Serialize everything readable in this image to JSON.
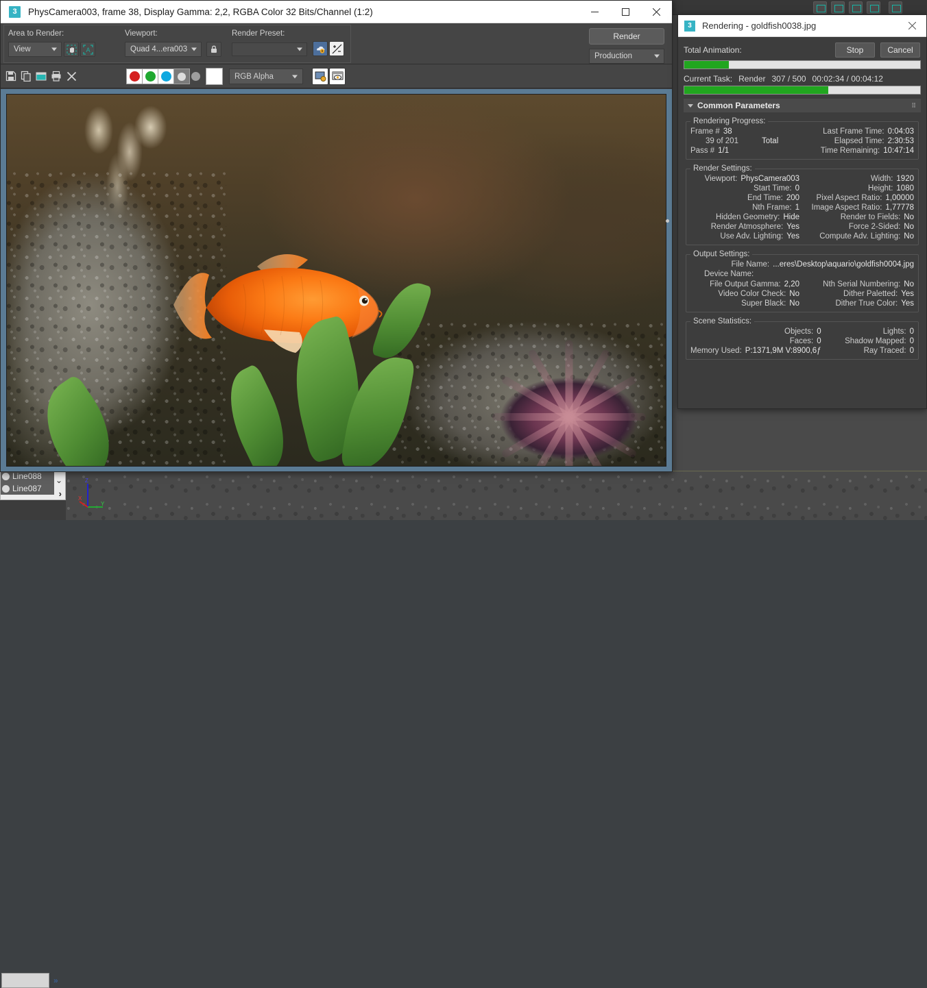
{
  "render_frame_window": {
    "title": "PhysCamera003, frame 38, Display Gamma: 2,2, RGBA Color 32 Bits/Channel (1:2)",
    "app_icon_label": "3",
    "window_controls": {
      "minimize": "–",
      "maximize": "□",
      "close": "✕"
    },
    "toolbar": {
      "area_to_render_label": "Area to Render:",
      "area_to_render_value": "View",
      "viewport_label": "Viewport:",
      "viewport_value": "Quad 4...era003",
      "render_preset_label": "Render Preset:",
      "render_preset_value": "",
      "render_button": "Render",
      "production_value": "Production"
    },
    "toolbar2": {
      "channel_value": "RGB Alpha",
      "icons": [
        "save-icon",
        "copy-icon",
        "clone-icon",
        "print-icon",
        "clear-icon"
      ]
    }
  },
  "rendering_dialog": {
    "title": "Rendering - goldfish0038.jpg",
    "app_icon_label": "3",
    "close_label": "✕",
    "stop_button": "Stop",
    "cancel_button": "Cancel",
    "total_animation_label": "Total Animation:",
    "total_animation_percent": 19,
    "current_task_label": "Current Task:",
    "current_task_name": "Render",
    "current_task_count": "307 / 500",
    "current_task_time": "00:02:34 / 00:04:12",
    "current_task_percent": 61,
    "rollout_title": "Common Parameters",
    "rendering_progress": {
      "legend": "Rendering Progress:",
      "rows": [
        {
          "k": "Frame #",
          "v": "38",
          "align": "left"
        },
        {
          "k": "Last Frame Time:",
          "v": "0:04:03",
          "align": "right"
        },
        {
          "k": "39 of 201",
          "v": "Total",
          "align": "left"
        },
        {
          "k": "Elapsed Time:",
          "v": "2:30:53",
          "align": "right"
        },
        {
          "k": "Pass #",
          "v": "1/1",
          "align": "left"
        },
        {
          "k": "Time Remaining:",
          "v": "10:47:14",
          "align": "right"
        }
      ]
    },
    "render_settings": {
      "legend": "Render Settings:",
      "rows": [
        {
          "k": "Viewport:",
          "v": "PhysCamera003"
        },
        {
          "k": "Width:",
          "v": "1920"
        },
        {
          "k": "Start Time:",
          "v": "0"
        },
        {
          "k": "Height:",
          "v": "1080"
        },
        {
          "k": "End Time:",
          "v": "200"
        },
        {
          "k": "Pixel Aspect Ratio:",
          "v": "1,00000"
        },
        {
          "k": "Nth Frame:",
          "v": "1"
        },
        {
          "k": "Image Aspect Ratio:",
          "v": "1,77778"
        },
        {
          "k": "Hidden Geometry:",
          "v": "Hide"
        },
        {
          "k": "Render to Fields:",
          "v": "No"
        },
        {
          "k": "Render Atmosphere:",
          "v": "Yes"
        },
        {
          "k": "Force 2-Sided:",
          "v": "No"
        },
        {
          "k": "Use Adv. Lighting:",
          "v": "Yes"
        },
        {
          "k": "Compute Adv. Lighting:",
          "v": "No"
        }
      ]
    },
    "output_settings": {
      "legend": "Output Settings:",
      "file_name_key": "File Name:",
      "file_name_value": "...eres\\Desktop\\aquario\\goldfish0004.jpg",
      "device_name_key": "Device Name:",
      "device_name_value": "",
      "rows": [
        {
          "k": "File Output Gamma:",
          "v": "2,20"
        },
        {
          "k": "Nth Serial Numbering:",
          "v": "No"
        },
        {
          "k": "Video Color Check:",
          "v": "No"
        },
        {
          "k": "Dither Paletted:",
          "v": "Yes"
        },
        {
          "k": "Super Black:",
          "v": "No"
        },
        {
          "k": "Dither True Color:",
          "v": "Yes"
        }
      ]
    },
    "scene_statistics": {
      "legend": "Scene Statistics:",
      "rows": [
        {
          "k": "Objects:",
          "v": "0"
        },
        {
          "k": "Lights:",
          "v": "0"
        },
        {
          "k": "Faces:",
          "v": "0"
        },
        {
          "k": "Shadow Mapped:",
          "v": "0"
        },
        {
          "k": "Memory Used:",
          "v": "P:1371,9M V:8900,6ƒ"
        },
        {
          "k": "Ray Traced:",
          "v": "0"
        }
      ]
    }
  },
  "background_app": {
    "object_list": [
      {
        "label": "Line088",
        "selected": true
      },
      {
        "label": "Line087",
        "selected": false
      }
    ],
    "chevron": "⌄",
    "arrow": "›",
    "double_arrow": "»",
    "axis_labels": {
      "x": "X",
      "y": "Y",
      "z": "Z"
    }
  },
  "colors": {
    "progress_green": "#21a61f",
    "accent_teal": "#36b3c4",
    "panel_bg": "#3d3d3d",
    "titlebar_bg": "#ffffff",
    "axis_x": "#cc2222",
    "axis_y": "#22aa33",
    "axis_z": "#2222cc"
  }
}
